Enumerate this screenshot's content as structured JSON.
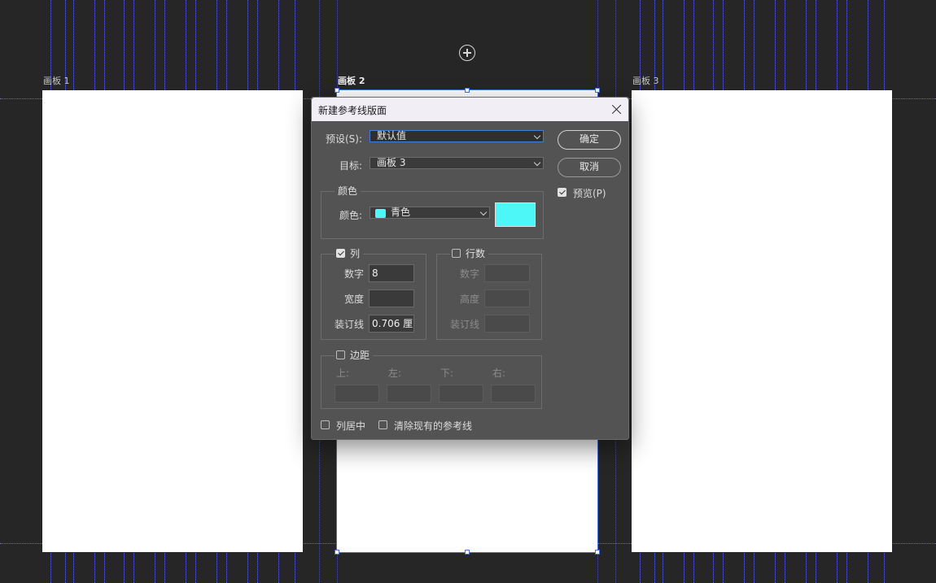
{
  "artboards": [
    {
      "label": "画板 1"
    },
    {
      "label": "画板 2"
    },
    {
      "label": "画板 3"
    }
  ],
  "dialog": {
    "title": "新建参考线版面",
    "preset_label": "预设(S):",
    "preset_value": "默认值",
    "target_label": "目标:",
    "target_value": "画板 3",
    "ok_label": "确定",
    "cancel_label": "取消",
    "preview_label": "预览(P)",
    "preview_checked": true,
    "color_group": {
      "legend": "颜色",
      "label": "颜色:",
      "value": "青色",
      "swatch_color": "#4df7f7"
    },
    "columns": {
      "legend": "列",
      "checked": true,
      "number_label": "数字",
      "number_value": "8",
      "width_label": "宽度",
      "width_value": "",
      "gutter_label": "装订线",
      "gutter_value": "0.706 厘"
    },
    "rows": {
      "legend": "行数",
      "checked": false,
      "number_label": "数字",
      "height_label": "高度",
      "gutter_label": "装订线"
    },
    "margins": {
      "legend": "边距",
      "checked": false,
      "top_label": "上:",
      "left_label": "左:",
      "bottom_label": "下:",
      "right_label": "右:"
    },
    "center_columns_label": "列居中",
    "clear_guides_label": "清除现有的参考线"
  },
  "colors": {
    "canvas": "#262626",
    "dialog_bg": "#535353",
    "titlebar": "#f2eef6",
    "guide": "#5b6ee0",
    "cyan": "#4df7f7"
  }
}
